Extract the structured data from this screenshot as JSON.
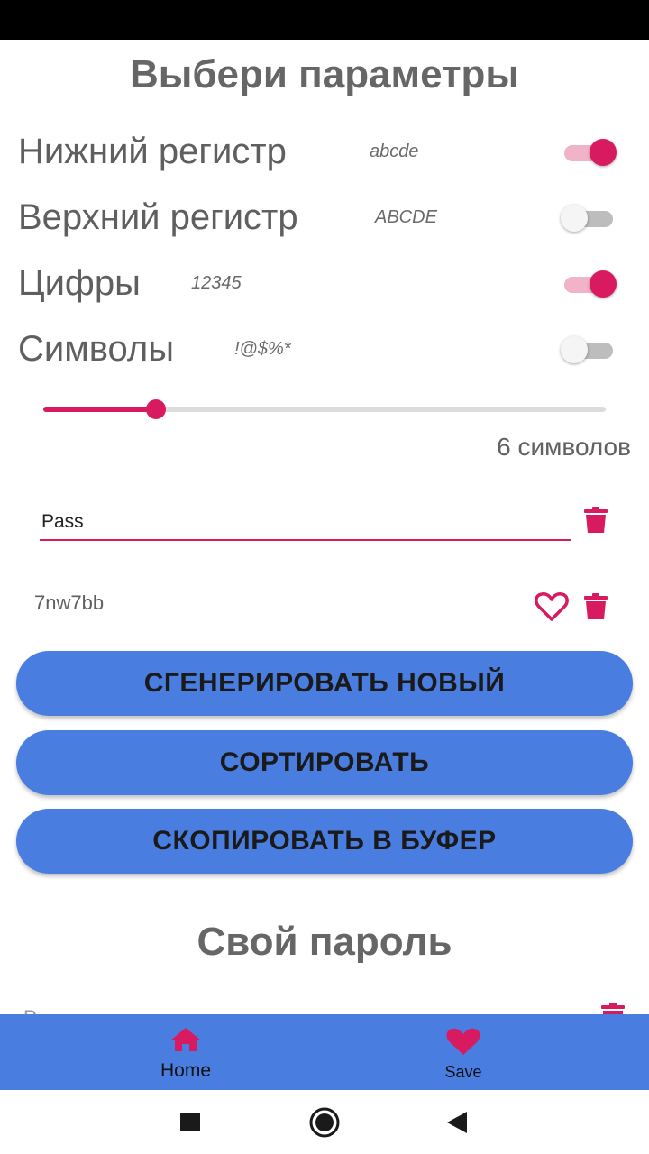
{
  "title": "Выбери параметры",
  "options": [
    {
      "label": "Нижний регистр",
      "example": "abcde",
      "enabled": true
    },
    {
      "label": "Верхний регистр",
      "example": "ABCDE",
      "enabled": false
    },
    {
      "label": "Цифры",
      "example": "12345",
      "enabled": true
    },
    {
      "label": "Символы",
      "example": "!@$%*",
      "enabled": false
    }
  ],
  "length": {
    "value": 0.2,
    "text": "6 символов"
  },
  "name_input": {
    "value": "Pass"
  },
  "generated": {
    "password": "7nw7bb"
  },
  "buttons": {
    "generate": "СГЕНЕРИРОВАТЬ НОВЫЙ",
    "sort": "СОРТИРОВАТЬ",
    "copy": "СКОПИРОВАТЬ В БУФЕР"
  },
  "own_password": {
    "title": "Свой пароль",
    "partial_text": "P"
  },
  "bottom_nav": {
    "items": [
      {
        "label": "Home",
        "icon": "home-icon"
      },
      {
        "label": "Save",
        "icon": "heart-icon"
      }
    ]
  },
  "system_nav": {
    "icons": [
      "recent-apps-icon",
      "home-circle-icon",
      "back-icon"
    ]
  },
  "colors": {
    "accent": "#d81b60",
    "primary": "#4a7de0",
    "text": "#5f5f5f"
  }
}
